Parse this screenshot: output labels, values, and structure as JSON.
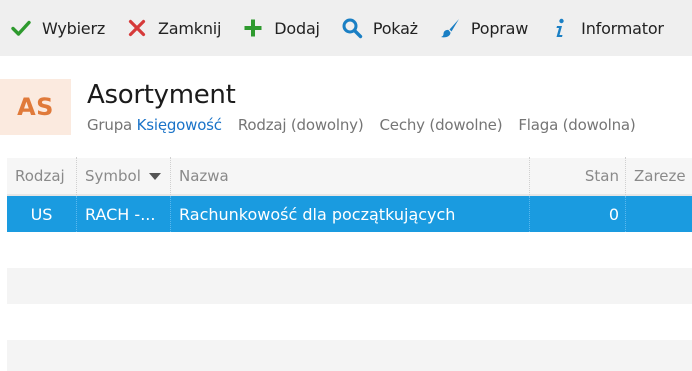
{
  "toolbar": {
    "buttons": [
      {
        "label": "Wybierz",
        "icon": "checkmark-icon",
        "color": "#2e9a2e"
      },
      {
        "label": "Zamknij",
        "icon": "close-icon",
        "color": "#d63a3a"
      },
      {
        "label": "Dodaj",
        "icon": "plus-icon",
        "color": "#2e9a2e"
      },
      {
        "label": "Pokaż",
        "icon": "search-icon",
        "color": "#1a7fc4"
      },
      {
        "label": "Popraw",
        "icon": "brush-icon",
        "color": "#1a7fc4"
      },
      {
        "label": "Informator",
        "icon": "info-icon",
        "color": "#1a7fc4"
      }
    ]
  },
  "header": {
    "badge": "AS",
    "badge_color": "#e07a3a",
    "title": "Asortyment",
    "filters": {
      "grupa_label": "Grupa",
      "grupa_value": "Księgowość",
      "rodzaj": "Rodzaj (dowolny)",
      "cechy": "Cechy (dowolne)",
      "flaga": "Flaga (dowolna)"
    }
  },
  "grid": {
    "columns": {
      "rodzaj": "Rodzaj",
      "symbol": "Symbol",
      "nazwa": "Nazwa",
      "stan": "Stan",
      "zarezerwowano": "Zareze"
    },
    "rows": [
      {
        "rodzaj": "US",
        "symbol": "RACH -...",
        "nazwa": "Rachunkowość dla początkujących",
        "stan": "0",
        "zarezerwowano": ""
      }
    ],
    "selection_color": "#1a9be0"
  }
}
